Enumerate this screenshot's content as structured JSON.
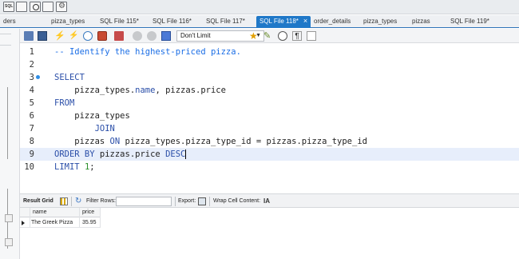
{
  "tabs": [
    {
      "label": "ders",
      "closable": false
    },
    {
      "label": "pizza_types",
      "closable": false
    },
    {
      "label": "SQL File 115*",
      "closable": false
    },
    {
      "label": "SQL File 116*",
      "closable": false
    },
    {
      "label": "SQL File 117*",
      "closable": false
    },
    {
      "label": "SQL File 118*",
      "closable": true,
      "active": true
    },
    {
      "label": "order_details",
      "closable": false
    },
    {
      "label": "pizza_types",
      "closable": false
    },
    {
      "label": "pizzas",
      "closable": false
    },
    {
      "label": "SQL File 119*",
      "closable": false
    }
  ],
  "active_tab_close": "×",
  "toolbar": {
    "limit_value": "Don't Limit",
    "icons": [
      "open-folder-icon",
      "save-icon",
      "execute-icon",
      "execute-current-icon",
      "explain-icon",
      "stop-icon",
      "toggle-output-icon",
      "commit-icon",
      "rollback-icon",
      "autocommit-icon",
      "bookmark-icon",
      "beautify-icon",
      "find-icon",
      "invisible-chars-icon",
      "word-wrap-icon"
    ]
  },
  "editor": {
    "lines": [
      {
        "num": "1",
        "parts": [
          {
            "t": "-- Identify the highest-priced pizza.",
            "c": "cm"
          }
        ]
      },
      {
        "num": "2",
        "parts": []
      },
      {
        "num": "3",
        "fold": true,
        "parts": [
          {
            "t": "SELECT",
            "c": "kw"
          }
        ]
      },
      {
        "num": "4",
        "parts": [
          {
            "t": "    pizza_types.",
            "c": "tx"
          },
          {
            "t": "name",
            "c": "fn"
          },
          {
            "t": ", pizzas.price",
            "c": "tx"
          }
        ]
      },
      {
        "num": "5",
        "parts": [
          {
            "t": "FROM",
            "c": "kw"
          }
        ]
      },
      {
        "num": "6",
        "parts": [
          {
            "t": "    pizza_types",
            "c": "tx"
          }
        ]
      },
      {
        "num": "7",
        "parts": [
          {
            "t": "        JOIN",
            "c": "kw"
          }
        ]
      },
      {
        "num": "8",
        "parts": [
          {
            "t": "    pizzas ",
            "c": "tx"
          },
          {
            "t": "ON",
            "c": "kw"
          },
          {
            "t": " pizza_types.pizza_type_id = pizzas.pizza_type_id",
            "c": "tx"
          }
        ]
      },
      {
        "num": "9",
        "current": true,
        "parts": [
          {
            "t": "ORDER BY",
            "c": "kw"
          },
          {
            "t": " pizzas.price ",
            "c": "tx"
          },
          {
            "t": "DESC",
            "c": "kw"
          }
        ]
      },
      {
        "num": "10",
        "parts": [
          {
            "t": "LIMIT",
            "c": "kw"
          },
          {
            "t": " ",
            "c": "tx"
          },
          {
            "t": "1",
            "c": "num"
          },
          {
            "t": ";",
            "c": "tx"
          }
        ]
      }
    ]
  },
  "result_toolbar": {
    "result_grid_label": "Result Grid",
    "filter_label": "Filter Rows:",
    "filter_value": "",
    "export_label": "Export:",
    "wrap_label": "Wrap Cell Content:",
    "wrap_icon": "IA"
  },
  "grid": {
    "columns": [
      "name",
      "price"
    ],
    "rows": [
      [
        "The Greek Pizza",
        "35.95"
      ]
    ]
  },
  "colors": {
    "active_tab": "#1f78c8",
    "keyword": "#2a4ea8",
    "comment": "#1b6ee6",
    "number": "#2a8f2a"
  }
}
